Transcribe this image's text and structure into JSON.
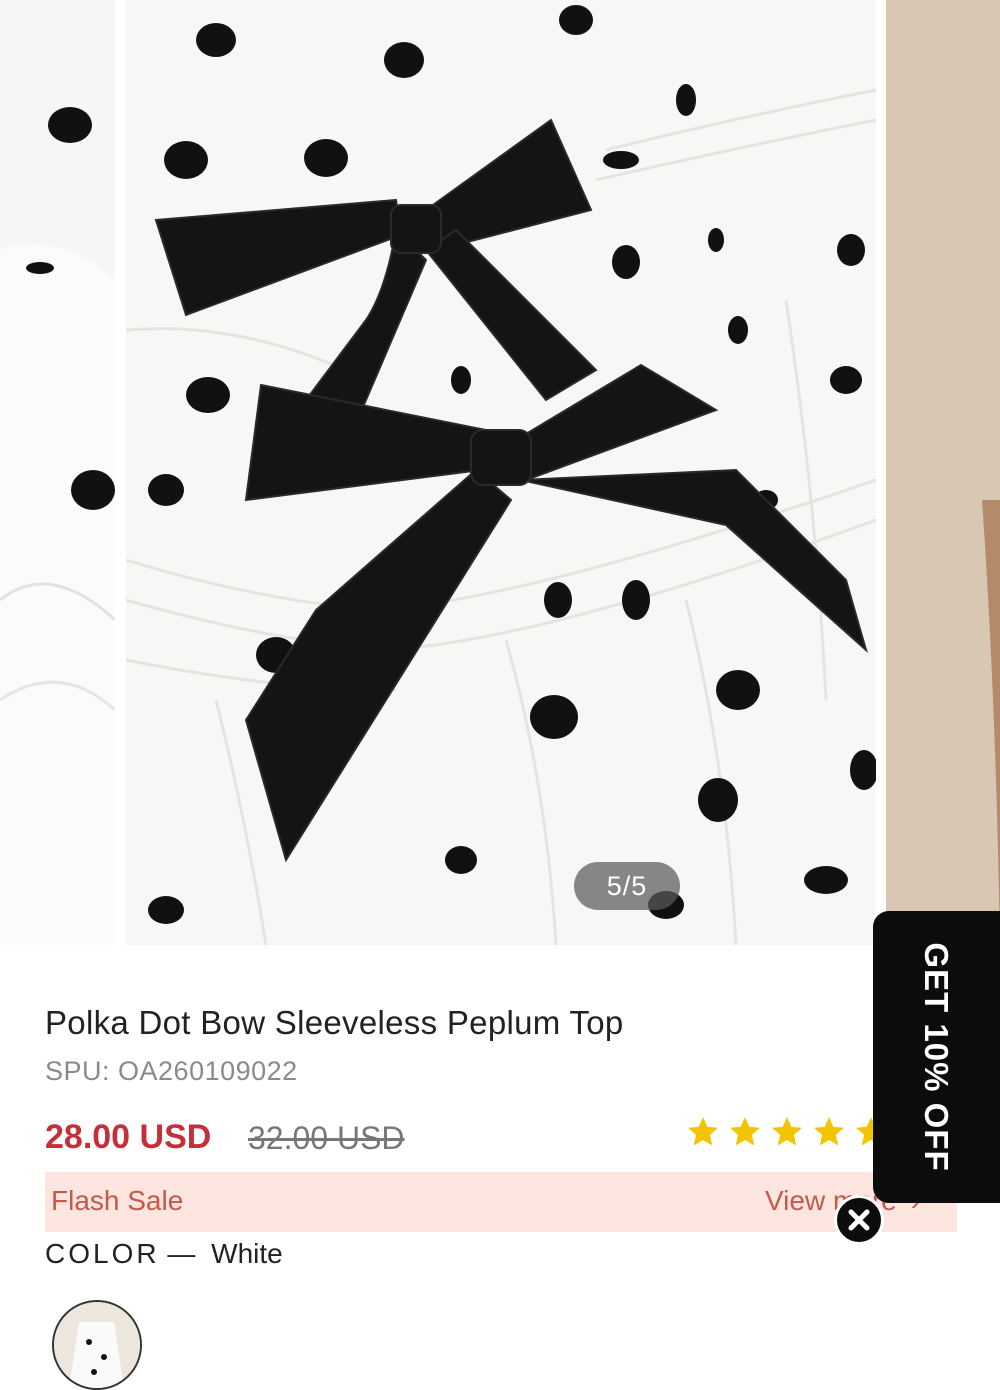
{
  "gallery": {
    "counter": "5/5",
    "current_index": 5,
    "total": 5
  },
  "product": {
    "title": "Polka Dot Bow Sleeveless Peplum Top",
    "spu_label": "SPU:",
    "spu_value": "OA260109022",
    "price": "28.00 USD",
    "original_price": "32.00 USD",
    "rating_stars": 5
  },
  "flash_sale": {
    "label": "Flash Sale",
    "view_more": "View more"
  },
  "color": {
    "label": "COLOR",
    "separator": "—",
    "value": "White"
  },
  "promo": {
    "text": "GET 10% OFF",
    "background": "#0c0c0c"
  },
  "colors": {
    "price": "#c4303a",
    "flash_bg": "#fde5e0",
    "flash_text": "#c7584a",
    "star": "#f5c400"
  }
}
